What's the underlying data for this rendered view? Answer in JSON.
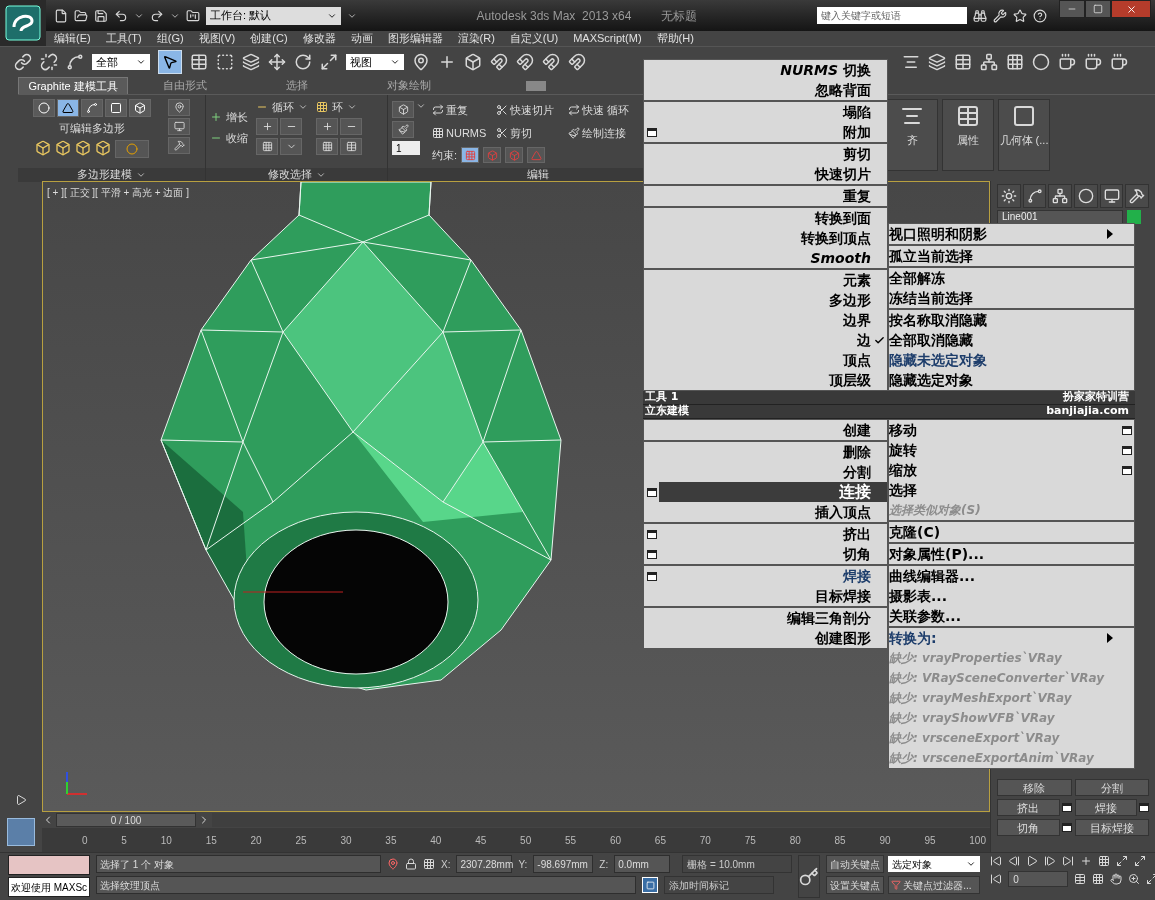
{
  "title_bar": {
    "workspace": "工作台: 默认",
    "app_title": "Autodesk 3ds Max  2013 x64",
    "document": "无标题",
    "search_placeholder": "键入关键字或短语"
  },
  "menu_bar": [
    "编辑(E)",
    "工具(T)",
    "组(G)",
    "视图(V)",
    "创建(C)",
    "修改器",
    "动画",
    "图形编辑器",
    "渲染(R)",
    "自定义(U)",
    "MAXScript(M)",
    "帮助(H)"
  ],
  "main_toolbar": {
    "selection_filter": "全部",
    "reference_coord": "视图"
  },
  "ribbon": {
    "tabs": [
      {
        "label": "Graphite 建模工具",
        "selected": true
      },
      {
        "label": "自由形式",
        "selected": false
      },
      {
        "label": "选择",
        "selected": false
      },
      {
        "label": "对象绘制",
        "selected": false
      }
    ],
    "poly_panel": {
      "title": "多边形建模",
      "label": "可编辑多边形",
      "dropdown": true
    },
    "selection_panel": {
      "title": "修改选择",
      "dropdown": true,
      "grow": "增长",
      "shrink": "收缩",
      "loop": "循环",
      "ring": "环"
    },
    "edit_panel": {
      "title": "编辑",
      "dropdown": false,
      "buttons": [
        "重复",
        "快速切片",
        "快速 循环",
        "NURMS",
        "剪切",
        "绘制连接"
      ],
      "constraint_label": "约束:",
      "spinner": "1"
    },
    "side_panels": [
      {
        "label": "齐"
      },
      {
        "label": "属性"
      },
      {
        "label": "几何体 (..."
      }
    ]
  },
  "viewport": {
    "label": "[ + ][ 正交 ][ 平滑 + 高光 + 边面 ]"
  },
  "quad_menu": {
    "top_left": [
      [
        {
          "label": "*NURMS* 切换",
          "kind": "normal",
          "selected": false
        },
        {
          "label": "忽略背面",
          "kind": "normal",
          "selected": false
        }
      ],
      [
        {
          "label": "塌陷",
          "kind": "normal",
          "selected": false
        },
        {
          "label": "附加",
          "kind": "normal",
          "selected": false,
          "options": true
        }
      ],
      [
        {
          "label": "剪切",
          "kind": "normal",
          "selected": false
        },
        {
          "label": "快速切片",
          "kind": "normal",
          "selected": false
        }
      ],
      [
        {
          "label": "重复",
          "kind": "normal",
          "selected": false
        }
      ],
      [
        {
          "label": "转换到面",
          "kind": "normal",
          "selected": false
        },
        {
          "label": "转换到顶点",
          "kind": "normal",
          "selected": false
        },
        {
          "label": "Smooth",
          "kind": "italic",
          "selected": false
        }
      ],
      [
        {
          "label": "元素",
          "kind": "normal",
          "selected": false
        },
        {
          "label": "多边形",
          "kind": "normal",
          "selected": false
        },
        {
          "label": "边界",
          "kind": "normal",
          "selected": false
        },
        {
          "label": "边",
          "kind": "normal",
          "selected": false,
          "checked": true
        },
        {
          "label": "顶点",
          "kind": "normal",
          "selected": false
        },
        {
          "label": "顶层级",
          "kind": "normal",
          "selected": false
        }
      ]
    ],
    "top_right": [
      [
        {
          "label": "视口照明和阴影",
          "kind": "normal",
          "selected": false,
          "submenu": true
        }
      ],
      [
        {
          "label": "孤立当前选择",
          "kind": "normal",
          "selected": false
        }
      ],
      [
        {
          "label": "全部解冻",
          "kind": "normal",
          "selected": false
        },
        {
          "label": "冻结当前选择",
          "kind": "normal",
          "selected": false
        }
      ],
      [
        {
          "label": "按名称取消隐藏",
          "kind": "normal",
          "selected": false
        },
        {
          "label": "全部取消隐藏",
          "kind": "normal",
          "selected": false
        },
        {
          "label": "隐藏未选定对象",
          "kind": "recent",
          "selected": false
        },
        {
          "label": "隐藏选定对象",
          "kind": "normal",
          "selected": false
        }
      ]
    ],
    "headers": [
      {
        "left": "工具 1",
        "right": "扮家家特训营"
      },
      {
        "left": "立东建模",
        "right": "banjiajia.com"
      }
    ],
    "bottom_left": [
      [
        {
          "label": "创建",
          "kind": "normal",
          "selected": false
        }
      ],
      [
        {
          "label": "删除",
          "kind": "normal",
          "selected": false
        },
        {
          "label": "分割",
          "kind": "normal",
          "selected": false
        },
        {
          "label": "连接",
          "kind": "normal",
          "selected": true,
          "options": true
        },
        {
          "label": "插入顶点",
          "kind": "normal",
          "selected": false
        }
      ],
      [
        {
          "label": "挤出",
          "kind": "normal",
          "selected": false,
          "options": true
        },
        {
          "label": "切角",
          "kind": "normal",
          "selected": false,
          "options": true
        }
      ],
      [
        {
          "label": "焊接",
          "kind": "recent",
          "selected": false,
          "options": true
        },
        {
          "label": "目标焊接",
          "kind": "normal",
          "selected": false
        }
      ],
      [
        {
          "label": "编辑三角剖分",
          "kind": "normal",
          "selected": false
        },
        {
          "label": "创建图形",
          "kind": "normal",
          "selected": false
        }
      ]
    ],
    "bottom_right": [
      [
        {
          "label": "移动",
          "kind": "normal",
          "selected": false,
          "options": true
        },
        {
          "label": "旋转",
          "kind": "normal",
          "selected": false,
          "options": true
        },
        {
          "label": "缩放",
          "kind": "normal",
          "selected": false,
          "options": true
        },
        {
          "label": "选择",
          "kind": "normal",
          "selected": false
        },
        {
          "label": "选择类似对象(S)",
          "kind": "disabled",
          "selected": false
        }
      ],
      [
        {
          "label": "克隆(C)",
          "kind": "normal",
          "selected": false
        }
      ],
      [
        {
          "label": "对象属性(P)...",
          "kind": "normal",
          "selected": false
        }
      ],
      [
        {
          "label": "曲线编辑器...",
          "kind": "normal",
          "selected": false
        },
        {
          "label": "摄影表...",
          "kind": "normal",
          "selected": false
        },
        {
          "label": "关联参数...",
          "kind": "normal",
          "selected": false
        }
      ],
      [
        {
          "label": "转换为:",
          "kind": "recent",
          "selected": false,
          "submenu": true
        },
        {
          "label": "缺少: vrayProperties`VRay",
          "kind": "disabled",
          "selected": false
        },
        {
          "label": "缺少: VRaySceneConverter`VRay",
          "kind": "disabled",
          "selected": false
        },
        {
          "label": "缺少: vrayMeshExport`VRay",
          "kind": "disabled",
          "selected": false
        },
        {
          "label": "缺少: vrayShowVFB`VRay",
          "kind": "disabled",
          "selected": false
        },
        {
          "label": "缺少: vrsceneExport`VRay",
          "kind": "disabled",
          "selected": false
        },
        {
          "label": "缺少: vrsceneExportAnim`VRay",
          "kind": "disabled",
          "selected": false
        }
      ]
    ]
  },
  "command_panel": {
    "object_name": "Line001",
    "buttons": [
      {
        "label": "移除",
        "options": false
      },
      {
        "label": "分割",
        "options": false
      },
      {
        "label": "挤出",
        "options": true
      },
      {
        "label": "焊接",
        "options": true
      },
      {
        "label": "切角",
        "options": true
      },
      {
        "label": "目标焊接",
        "options": false
      }
    ]
  },
  "timeline": {
    "position": "0 / 100",
    "ruler_labels": [
      "0",
      "5",
      "10",
      "15",
      "20",
      "25",
      "30",
      "35",
      "40",
      "45",
      "50",
      "55",
      "60",
      "65",
      "70",
      "75",
      "80",
      "85",
      "90",
      "95",
      "100"
    ]
  },
  "status_bar": {
    "listener": "欢迎使用 MAXSc",
    "selection_info": "选择了 1 个 对象",
    "prompt": "选择纹理顶点",
    "x_label": "X:",
    "x": "2307.28mm",
    "y_label": "Y:",
    "y": "-98.697mm",
    "z_label": "Z:",
    "z": "0.0mm",
    "grid": "栅格 = 10.0mm",
    "add_time_tag": "添加时间标记",
    "auto_key": "自动关键点",
    "set_key": "设置关键点",
    "key_mode": "选定对象",
    "key_filters": "关键点过滤器...",
    "frame": "0"
  }
}
